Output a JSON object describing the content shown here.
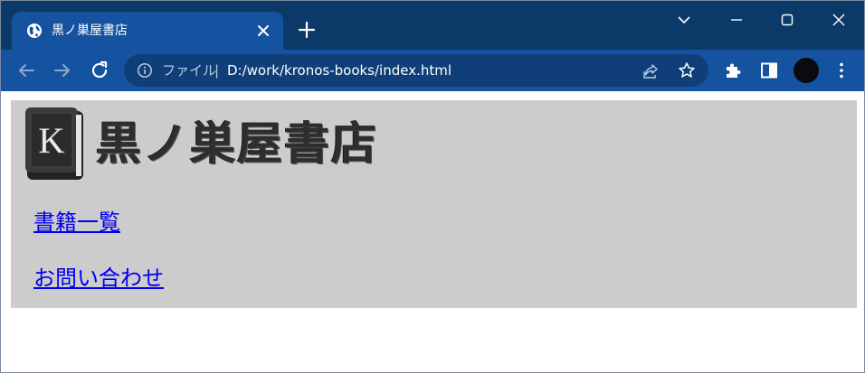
{
  "browser": {
    "tab": {
      "title": "黒ノ巣屋書店",
      "favicon": "globe-icon"
    },
    "address_bar": {
      "scheme_label": "ファイル",
      "separator": "|",
      "url": "D:/work/kronos-books/index.html"
    },
    "colors": {
      "frame": "#0c3a68",
      "toolbar": "#1553a0",
      "omnibox": "#0f3e78"
    }
  },
  "page": {
    "site_title": "黒ノ巣屋書店",
    "logo_letter": "K",
    "nav": [
      {
        "label": "書籍一覧"
      },
      {
        "label": "お問い合わせ"
      }
    ],
    "colors": {
      "header_bg": "#cccccc",
      "link": "#0000ee"
    }
  }
}
